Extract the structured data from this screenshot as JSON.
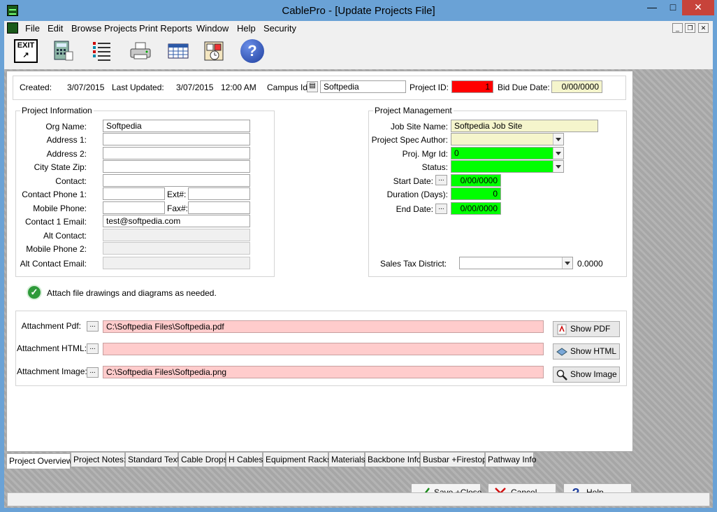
{
  "window": {
    "title": "CablePro - [Update Projects File]"
  },
  "menu": [
    "File",
    "Edit",
    "Browse Projects",
    "Print Reports",
    "Window",
    "Help",
    "Security"
  ],
  "toolbar": {
    "exit_label": "EXIT",
    "help_label": "?"
  },
  "header": {
    "created_label": "Created:",
    "created_value": "3/07/2015",
    "updated_label": "Last Updated:",
    "updated_date": "3/07/2015",
    "updated_time": "12:00 AM",
    "campus_label": "Campus Id:",
    "campus_value": "Softpedia",
    "project_id_label": "Project ID:",
    "project_id_value": "1",
    "bid_due_label": "Bid Due Date:",
    "bid_due_value": "0/00/0000"
  },
  "project_info": {
    "title": "Project Information",
    "org_label": "Org Name:",
    "org_value": "Softpedia",
    "addr1_label": "Address 1:",
    "addr2_label": "Address 2:",
    "city_label": "City State Zip:",
    "contact_label": "Contact:",
    "phone1_label": "Contact Phone 1:",
    "ext_label": "Ext#:",
    "mobile_label": "Mobile Phone:",
    "fax_label": "Fax#:",
    "email1_label": "Contact 1 Email:",
    "email1_value": "test@softpedia.com",
    "alt_contact_label": "Alt Contact:",
    "mobile2_label": "Mobile Phone 2:",
    "alt_email_label": "Alt Contact Email:"
  },
  "project_mgmt": {
    "title": "Project Management",
    "site_label": "Job Site Name:",
    "site_value": "Softpedia Job Site",
    "spec_label": "Project Spec Author:",
    "mgr_label": "Proj. Mgr Id:",
    "mgr_value": "0",
    "status_label": "Status:",
    "start_label": "Start Date:",
    "start_value": "0/00/0000",
    "duration_label": "Duration (Days):",
    "duration_value": "0",
    "end_label": "End Date:",
    "end_value": "0/00/0000",
    "tax_label": "Sales Tax District:",
    "tax_value": "0.0000"
  },
  "attach": {
    "note": "Attach file drawings and diagrams as needed.",
    "pdf_label": "Attachment Pdf:",
    "pdf_value": "C:\\Softpedia Files\\Softpedia.pdf",
    "html_label": "Attachment HTML:",
    "html_value": "",
    "image_label": "Attachment Image:",
    "image_value": "C:\\Softpedia Files\\Softpedia.png",
    "show_pdf": "Show PDF",
    "show_html": "Show HTML",
    "show_image": "Show Image",
    "dots": "..."
  },
  "tabs": [
    "Project Overview",
    "Project Notes:",
    "Standard Text",
    "Cable Drops",
    "H Cables",
    "Equipment Racks",
    "Materials",
    "Backbone Info",
    "Busbar +Firestops",
    "Pathway Info"
  ],
  "buttons": {
    "save": "Save +Close",
    "cancel": "Cancel",
    "help": "Help"
  },
  "colors": {
    "title_bar": "#6aa2d6",
    "required_field": "#00ff00",
    "project_id": "#ff0000",
    "attachment": "#ffcccc",
    "highlight": "#f5f5cc"
  }
}
